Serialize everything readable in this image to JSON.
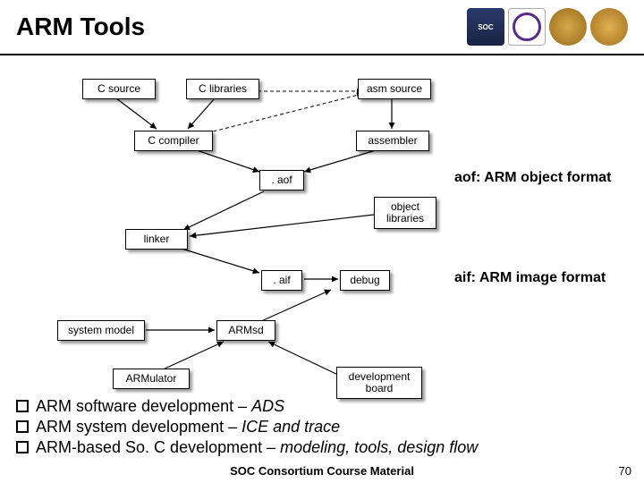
{
  "title": "ARM Tools",
  "logos": [
    "SOC",
    "",
    "",
    ""
  ],
  "nodes": {
    "c_source": "C source",
    "c_libraries": "C libraries",
    "asm_source": "asm source",
    "c_compiler": "C compiler",
    "assembler": "assembler",
    "aof": ". aof",
    "object_libraries": "object\nlibraries",
    "linker": "linker",
    "aif": ". aif",
    "debug": "debug",
    "system_model": "system model",
    "armsd": "ARMsd",
    "armulator": "ARMulator",
    "dev_board": "development\nboard"
  },
  "annotations": {
    "aof": "aof: ARM object format",
    "aif": "aif: ARM image format"
  },
  "bullets": [
    {
      "pre": "ARM software development – ",
      "it": "ADS"
    },
    {
      "pre": "ARM system development – ",
      "it": "ICE and trace"
    },
    {
      "pre": "ARM-based So. C development – ",
      "it": "modeling, tools, design flow"
    }
  ],
  "footer": "SOC Consortium Course Material",
  "page": "70"
}
